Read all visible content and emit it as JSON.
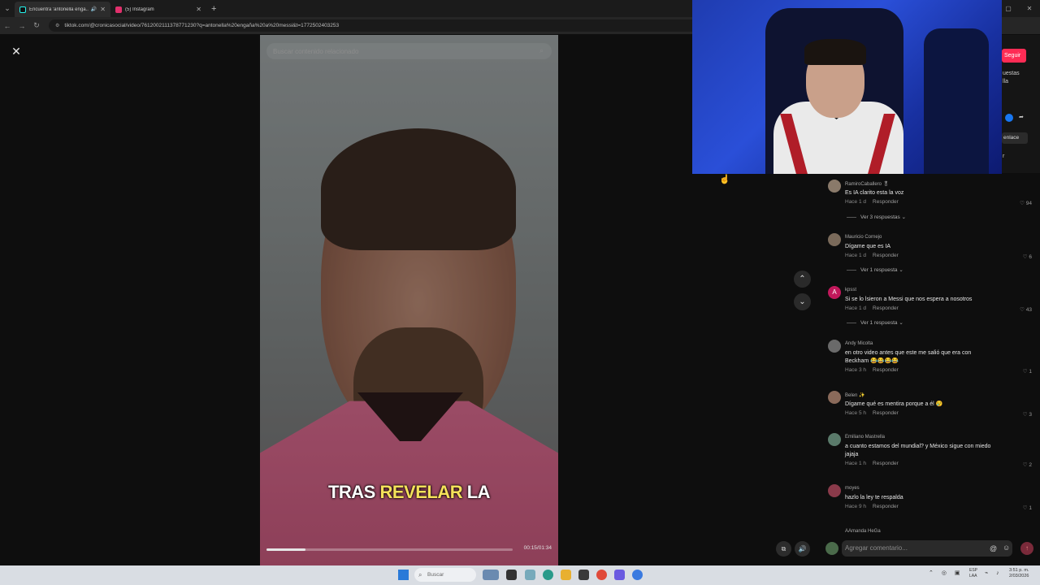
{
  "browser": {
    "tabs": [
      {
        "title": "Encuentra 'antonella enga...",
        "active": true,
        "favicon_color": "#25f4ee"
      },
      {
        "title": "(5) Instagram",
        "active": false,
        "favicon_color": "#e1306c"
      }
    ],
    "url": "tiktok.com/@cronicasocial/video/7612002111378771230?q=antonella%20engaña%20a%20messi&t=1772502403253"
  },
  "video": {
    "search_placeholder": "Buscar contenido relacionado",
    "caption_part1": "TRAS",
    "caption_highlight": "REVELAR",
    "caption_part2": "LA",
    "time": "00:15/01:34",
    "progress": 0.16
  },
  "side_peek": {
    "follow_label": "Seguir",
    "text1": "uestas",
    "text2": "lla",
    "link_label": "enlace",
    "text3": "r"
  },
  "comments": [
    {
      "user": "RamiroCaballero 🎖",
      "text": "Es IA clarito esta la voz",
      "time": "Hace 1 d",
      "reply": "Responder",
      "likes": "94",
      "more": "Ver 3 respuestas",
      "avatar_color": "#8a7a6a"
    },
    {
      "user": "Mauricio Cornejo",
      "text": "Dígame que es IA",
      "time": "Hace 1 d",
      "reply": "Responder",
      "likes": "6",
      "more": "Ver 1 respuesta",
      "avatar_color": "#7a6a5a"
    },
    {
      "user": "kpsst",
      "text": "Si se lo lsieron a Messi que nos espera a nosotros",
      "time": "Hace 1 d",
      "reply": "Responder",
      "likes": "43",
      "more": "Ver 1 respuesta",
      "avatar_color": "#c2185b",
      "avatar_letter": "A"
    },
    {
      "user": "Andy Micolta",
      "text": "en otro video antes que este me salió que era con Beckham 😂😂😂😂",
      "time": "Hace 3 h",
      "reply": "Responder",
      "likes": "1",
      "avatar_color": "#6a6a6a"
    },
    {
      "user": "Belen ✨",
      "text": "Dígame qué es mentira porque a él 😢",
      "time": "Hace 5 h",
      "reply": "Responder",
      "likes": "3",
      "avatar_color": "#8a6a5a"
    },
    {
      "user": "Emiliano Mastrella",
      "text": "a cuanto estamos del mundial? y México sigue con miedo jajaja",
      "time": "Hace 1 h",
      "reply": "Responder",
      "likes": "2",
      "avatar_color": "#5a7a6a"
    },
    {
      "user": "moyes",
      "text": "hazlo la ley te respalda",
      "time": "Hace 9 h",
      "reply": "Responder",
      "likes": "1",
      "avatar_color": "#8a3a4a"
    },
    {
      "user": "AAmanda HeGa",
      "avatar_color": "#5a5a5a"
    }
  ],
  "comment_input": {
    "placeholder": "Agregar comentario..."
  },
  "taskbar": {
    "search_label": "Buscar",
    "lang_line1": "ESP",
    "lang_line2": "LAA",
    "time": "3:51 p. m.",
    "date": "2/03/2026"
  }
}
